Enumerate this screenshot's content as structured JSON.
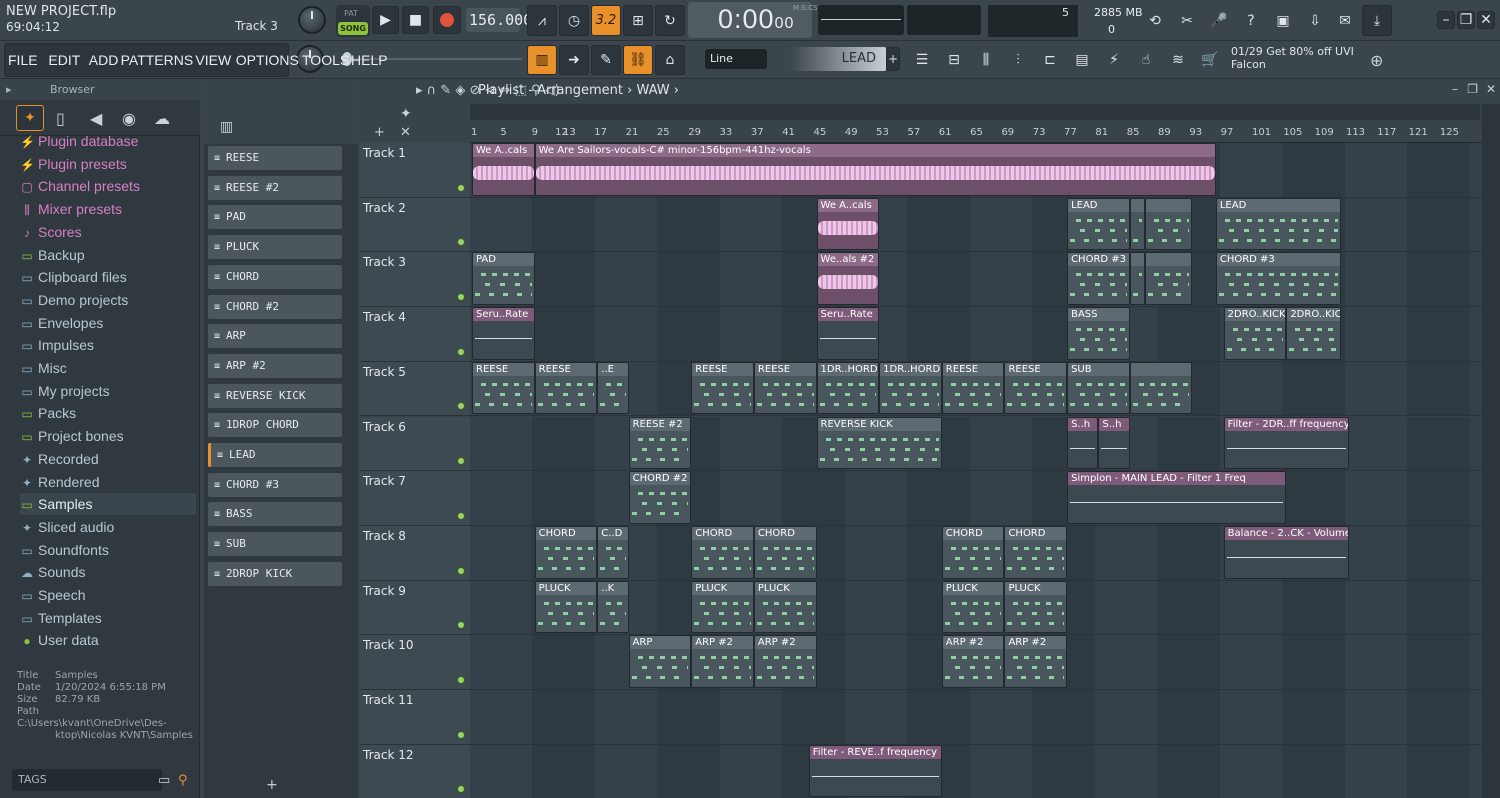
{
  "title_bar": {
    "project": "NEW PROJECT.flp",
    "time": "69:04:12",
    "track_hint": "Track 3"
  },
  "transport": {
    "pat": "PAT",
    "song": "SONG",
    "tempo": "156.000",
    "time": "0:00",
    "time_sub": "00",
    "time_unit": "M:S:CS",
    "snap_display": "3.2"
  },
  "cpu": {
    "poly": "5",
    "memory": "2885 MB",
    "zero": "0"
  },
  "menu": [
    "FILE",
    "EDIT",
    "ADD",
    "PATTERNS",
    "VIEW",
    "OPTIONS",
    "TOOLS",
    "HELP"
  ],
  "toolbar": {
    "snap_mode": "Line",
    "pattern": "LEAD"
  },
  "news": {
    "line1": "01/29  Get 80% off UVI",
    "line2": "Falcon"
  },
  "browser": {
    "title": "Browser",
    "items": [
      {
        "label": "Plugin database",
        "icon": "plug-icon"
      },
      {
        "label": "Plugin presets",
        "icon": "plug-icon"
      },
      {
        "label": "Channel presets",
        "icon": "channel-icon"
      },
      {
        "label": "Mixer presets",
        "icon": "mixer-icon"
      },
      {
        "label": "Scores",
        "icon": "note-icon"
      },
      {
        "label": "Backup",
        "icon": "folder-icon"
      },
      {
        "label": "Clipboard files",
        "icon": "folder-icon"
      },
      {
        "label": "Demo projects",
        "icon": "folder-icon"
      },
      {
        "label": "Envelopes",
        "icon": "folder-icon"
      },
      {
        "label": "Impulses",
        "icon": "folder-icon"
      },
      {
        "label": "Misc",
        "icon": "folder-icon"
      },
      {
        "label": "My projects",
        "icon": "folder-icon"
      },
      {
        "label": "Packs",
        "icon": "folder-icon"
      },
      {
        "label": "Project bones",
        "icon": "folder-icon"
      },
      {
        "label": "Recorded",
        "icon": "plus-icon"
      },
      {
        "label": "Rendered",
        "icon": "plus-icon"
      },
      {
        "label": "Samples",
        "icon": "folder-icon"
      },
      {
        "label": "Sliced audio",
        "icon": "plus-icon"
      },
      {
        "label": "Soundfonts",
        "icon": "folder-icon"
      },
      {
        "label": "Sounds",
        "icon": "cloud-icon"
      },
      {
        "label": "Speech",
        "icon": "folder-icon"
      },
      {
        "label": "Templates",
        "icon": "folder-icon"
      },
      {
        "label": "User data",
        "icon": "user-icon"
      }
    ],
    "info": {
      "title_k": "Title",
      "title_v": "Samples",
      "date_k": "Date",
      "date_v": "1/20/2024 6:55:18 PM",
      "size_k": "Size",
      "size_v": "82.79 KB",
      "path_k": "Path",
      "path_v1": "C:\\Users\\kvant\\OneDrive\\Des-",
      "path_v2": "ktop\\Nicolas KVNT\\Samples"
    },
    "tags": "TAGS"
  },
  "channels": [
    "REESE",
    "REESE #2",
    "PAD",
    "PLUCK",
    "CHORD",
    "CHORD #2",
    "ARP",
    "ARP #2",
    "REVERSE KICK",
    "1DROP CHORD",
    "LEAD",
    "CHORD #3",
    "BASS",
    "SUB",
    "2DROP KICK"
  ],
  "playlist": {
    "title": "Playlist - Arrangement",
    "pattern": "WAW",
    "bars": [
      "1",
      "5",
      "9",
      "13",
      "17",
      "21",
      "25",
      "29",
      "33",
      "37",
      "41",
      "45",
      "49",
      "53",
      "57",
      "61",
      "65",
      "69",
      "73",
      "77",
      "81",
      "85",
      "89",
      "93",
      "97",
      "101",
      "105",
      "109",
      "113",
      "117",
      "121",
      "125",
      "12"
    ],
    "tracks": [
      "Track 1",
      "Track 2",
      "Track 3",
      "Track 4",
      "Track 5",
      "Track 6",
      "Track 7",
      "Track 8",
      "Track 9",
      "Track 10",
      "Track 11",
      "Track 12"
    ],
    "clips": [
      {
        "t": 0,
        "b": 1,
        "e": 9,
        "k": "aud",
        "l": "We A..cals"
      },
      {
        "t": 0,
        "b": 9,
        "e": 96,
        "k": "aud",
        "l": "We Are Sailors-vocals-C# minor-156bpm-441hz-vocals"
      },
      {
        "t": 1,
        "b": 45,
        "e": 53,
        "k": "aud",
        "l": "We A..cals"
      },
      {
        "t": 1,
        "b": 77,
        "e": 85,
        "k": "pat",
        "l": "LEAD"
      },
      {
        "t": 1,
        "b": 85,
        "e": 87,
        "k": "pat",
        "l": ""
      },
      {
        "t": 1,
        "b": 87,
        "e": 93,
        "k": "pat",
        "l": ""
      },
      {
        "t": 1,
        "b": 96,
        "e": 112,
        "k": "pat",
        "l": "LEAD"
      },
      {
        "t": 2,
        "b": 1,
        "e": 9,
        "k": "pat",
        "l": "PAD"
      },
      {
        "t": 2,
        "b": 45,
        "e": 53,
        "k": "aud",
        "l": "We..als #2"
      },
      {
        "t": 2,
        "b": 77,
        "e": 85,
        "k": "pat",
        "l": "CHORD #3"
      },
      {
        "t": 2,
        "b": 85,
        "e": 87,
        "k": "pat",
        "l": ""
      },
      {
        "t": 2,
        "b": 87,
        "e": 93,
        "k": "pat",
        "l": ""
      },
      {
        "t": 2,
        "b": 96,
        "e": 112,
        "k": "pat",
        "l": "CHORD #3"
      },
      {
        "t": 3,
        "b": 1,
        "e": 9,
        "k": "aut",
        "l": "Seru..Rate"
      },
      {
        "t": 3,
        "b": 45,
        "e": 53,
        "k": "aut",
        "l": "Seru..Rate"
      },
      {
        "t": 3,
        "b": 77,
        "e": 85,
        "k": "pat",
        "l": "BASS"
      },
      {
        "t": 3,
        "b": 97,
        "e": 105,
        "k": "pat",
        "l": "2DRO..KICK"
      },
      {
        "t": 3,
        "b": 105,
        "e": 112,
        "k": "pat",
        "l": "2DRO..KICK"
      },
      {
        "t": 4,
        "b": 1,
        "e": 9,
        "k": "pat",
        "l": "REESE"
      },
      {
        "t": 4,
        "b": 9,
        "e": 17,
        "k": "pat",
        "l": "REESE"
      },
      {
        "t": 4,
        "b": 17,
        "e": 21,
        "k": "pat",
        "l": "..E"
      },
      {
        "t": 4,
        "b": 29,
        "e": 37,
        "k": "pat",
        "l": "REESE"
      },
      {
        "t": 4,
        "b": 37,
        "e": 45,
        "k": "pat",
        "l": "REESE"
      },
      {
        "t": 4,
        "b": 45,
        "e": 53,
        "k": "pat",
        "l": "1DR..HORD"
      },
      {
        "t": 4,
        "b": 53,
        "e": 61,
        "k": "pat",
        "l": "1DR..HORD"
      },
      {
        "t": 4,
        "b": 61,
        "e": 69,
        "k": "pat",
        "l": "REESE"
      },
      {
        "t": 4,
        "b": 69,
        "e": 77,
        "k": "pat",
        "l": "REESE"
      },
      {
        "t": 4,
        "b": 77,
        "e": 85,
        "k": "pat",
        "l": "SUB"
      },
      {
        "t": 4,
        "b": 85,
        "e": 93,
        "k": "pat",
        "l": ""
      },
      {
        "t": 5,
        "b": 21,
        "e": 29,
        "k": "pat",
        "l": "REESE #2"
      },
      {
        "t": 5,
        "b": 45,
        "e": 61,
        "k": "pat",
        "l": "REVERSE KICK"
      },
      {
        "t": 5,
        "b": 77,
        "e": 81,
        "k": "aut",
        "l": "S..h"
      },
      {
        "t": 5,
        "b": 81,
        "e": 85,
        "k": "aut",
        "l": "S..h"
      },
      {
        "t": 5,
        "b": 97,
        "e": 113,
        "k": "aut",
        "l": "Filter - 2DR..ff frequency"
      },
      {
        "t": 6,
        "b": 21,
        "e": 29,
        "k": "pat",
        "l": "CHORD #2"
      },
      {
        "t": 6,
        "b": 77,
        "e": 105,
        "k": "aut",
        "l": "Simplon - MAIN LEAD - Filter 1 Freq"
      },
      {
        "t": 7,
        "b": 9,
        "e": 17,
        "k": "pat",
        "l": "CHORD"
      },
      {
        "t": 7,
        "b": 17,
        "e": 21,
        "k": "pat",
        "l": "C..D"
      },
      {
        "t": 7,
        "b": 29,
        "e": 37,
        "k": "pat",
        "l": "CHORD"
      },
      {
        "t": 7,
        "b": 37,
        "e": 45,
        "k": "pat",
        "l": "CHORD"
      },
      {
        "t": 7,
        "b": 61,
        "e": 69,
        "k": "pat",
        "l": "CHORD"
      },
      {
        "t": 7,
        "b": 69,
        "e": 77,
        "k": "pat",
        "l": "CHORD"
      },
      {
        "t": 7,
        "b": 97,
        "e": 113,
        "k": "aut",
        "l": "Balance - 2..CK - Volume"
      },
      {
        "t": 8,
        "b": 9,
        "e": 17,
        "k": "pat",
        "l": "PLUCK"
      },
      {
        "t": 8,
        "b": 17,
        "e": 21,
        "k": "pat",
        "l": "..K"
      },
      {
        "t": 8,
        "b": 29,
        "e": 37,
        "k": "pat",
        "l": "PLUCK"
      },
      {
        "t": 8,
        "b": 37,
        "e": 45,
        "k": "pat",
        "l": "PLUCK"
      },
      {
        "t": 8,
        "b": 61,
        "e": 69,
        "k": "pat",
        "l": "PLUCK"
      },
      {
        "t": 8,
        "b": 69,
        "e": 77,
        "k": "pat",
        "l": "PLUCK"
      },
      {
        "t": 9,
        "b": 21,
        "e": 29,
        "k": "pat",
        "l": "ARP"
      },
      {
        "t": 9,
        "b": 29,
        "e": 37,
        "k": "pat",
        "l": "ARP #2"
      },
      {
        "t": 9,
        "b": 37,
        "e": 45,
        "k": "pat",
        "l": "ARP #2"
      },
      {
        "t": 9,
        "b": 61,
        "e": 69,
        "k": "pat",
        "l": "ARP #2"
      },
      {
        "t": 9,
        "b": 69,
        "e": 77,
        "k": "pat",
        "l": "ARP #2"
      },
      {
        "t": 11,
        "b": 44,
        "e": 61,
        "k": "aut",
        "l": "Filter - REVE..f frequency"
      }
    ]
  }
}
